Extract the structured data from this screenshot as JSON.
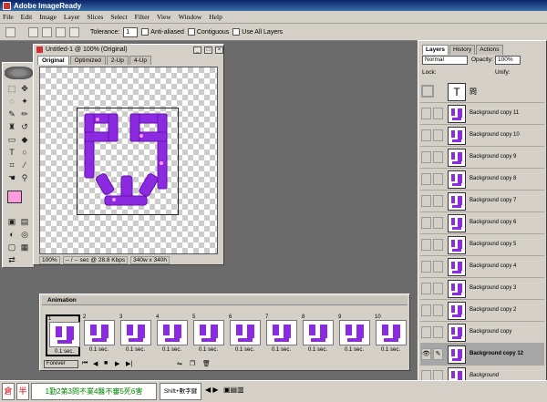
{
  "app": {
    "title": "Adobe ImageReady"
  },
  "menu": [
    "File",
    "Edit",
    "Image",
    "Layer",
    "Slices",
    "Select",
    "Filter",
    "View",
    "Window",
    "Help"
  ],
  "options": {
    "tolerance_label": "Tolerance:",
    "tolerance_value": "1",
    "anti_aliased": "Anti-aliased",
    "contiguous": "Contiguous",
    "use_all_layers": "Use All Layers"
  },
  "document": {
    "title": "Untitled-1 @ 100% (Original)",
    "tabs": [
      "Original",
      "Optimized",
      "2-Up",
      "4-Up"
    ],
    "status": {
      "zoom": "100%",
      "speed": "-- / -- sec @ 28.8 Kbps",
      "size": "340w x 340h"
    },
    "glyph": "問"
  },
  "layers_panel": {
    "tabs": [
      "Layers",
      "History",
      "Actions"
    ],
    "blend_mode": "Normal",
    "opacity_label": "Opacity:",
    "opacity": "100%",
    "lock_label": "Lock:",
    "unify_label": "Unify:",
    "text_layer_name": "問",
    "layers": [
      {
        "name": "Background copy 11"
      },
      {
        "name": "Background copy 10"
      },
      {
        "name": "Background copy 9"
      },
      {
        "name": "Background copy 8"
      },
      {
        "name": "Background copy 7"
      },
      {
        "name": "Background copy 6"
      },
      {
        "name": "Background copy 5"
      },
      {
        "name": "Background copy 4"
      },
      {
        "name": "Background copy 3"
      },
      {
        "name": "Background copy 2"
      },
      {
        "name": "Background copy"
      },
      {
        "name": "Background copy 12",
        "selected": true
      },
      {
        "name": "Background",
        "italic": true
      }
    ]
  },
  "animation": {
    "title": "Animation",
    "loop": "Forever",
    "frames": [
      {
        "num": "1",
        "delay": "0.1 sec."
      },
      {
        "num": "2",
        "delay": "0.1 sec."
      },
      {
        "num": "3",
        "delay": "0.1 sec."
      },
      {
        "num": "4",
        "delay": "0.1 sec."
      },
      {
        "num": "5",
        "delay": "0.1 sec."
      },
      {
        "num": "6",
        "delay": "0.1 sec."
      },
      {
        "num": "7",
        "delay": "0.1 sec."
      },
      {
        "num": "8",
        "delay": "0.1 sec."
      },
      {
        "num": "9",
        "delay": "0.1 sec."
      },
      {
        "num": "10",
        "delay": "0.1 sec."
      }
    ]
  },
  "ime": {
    "mode1": "倉",
    "mode2": "半",
    "candidates": "1勤2第3問不業4醫不審5死6害",
    "hint": "Shift+數字鍵"
  },
  "colors": {
    "glyph": "#8a2be2",
    "accent_fg": "#ff9ce0",
    "selected_row": "#a6a6a6"
  }
}
